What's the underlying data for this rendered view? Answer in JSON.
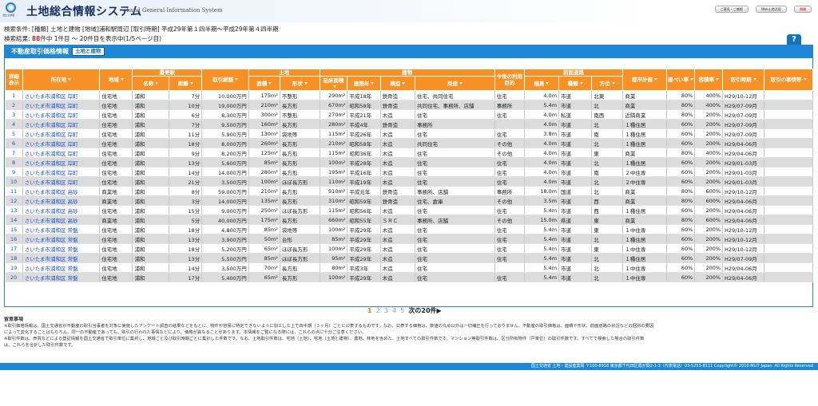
{
  "app": {
    "title": "土地総合情報システム",
    "subtitle": "Land General Information System",
    "logo_text": "国土交通省"
  },
  "header_buttons": [
    "ご意見・ご感想",
    "Web土地活用",
    "閉鎖"
  ],
  "search": {
    "conditions": "検索条件: [種類] 土地と建物 [地域]浦和駅周辺 [取引時期] 平成29年第１四半期〜平成29年第４四半期",
    "count_prefix": "検索結果:",
    "count_value": "88",
    "count_suffix": "件中 1件目 〜 20件目を表示中(1/5ページ目)"
  },
  "help_label": "?",
  "panel": {
    "title": "不動産取引価格情報",
    "tag": "土地と建物"
  },
  "columns": {
    "detail": "詳細表示",
    "location": "所在地",
    "district": "地域",
    "station_group": "最寄駅",
    "station_name": "名称",
    "distance": "距離",
    "price": "取引総額",
    "land_group": "土地",
    "area": "面積",
    "shape": "形状",
    "building_group": "建物",
    "floor_area": "延床面積",
    "year": "建築年",
    "structure": "構造",
    "use": "用途",
    "future_use": "今後の利用目的",
    "road_group": "前面道路",
    "width": "幅員",
    "road_type": "種類",
    "direction": "方位",
    "plan": "都市計画",
    "coverage": "建ぺい率",
    "far": "容積率",
    "period": "取引時期",
    "circumstances": "取引の事情等"
  },
  "rows": [
    [
      "1",
      "さいたま市浦和区 岸町",
      "住宅地",
      "浦和",
      "7分",
      "10,000万円",
      "175m²",
      "不整形",
      "290m²",
      "平成18年",
      "鉄骨造",
      "住宅、共同住宅",
      "住宅",
      "4.0m",
      "市道",
      "北東",
      "商業",
      "80%",
      "400%",
      "H29/10-12月",
      ""
    ],
    [
      "2",
      "さいたま市浦和区 岸町",
      "住宅地",
      "浦和",
      "10分",
      "19,000万円",
      "210m²",
      "長方形",
      "670m²",
      "昭和58年",
      "鉄骨造",
      "共同住宅、事務所、店舗",
      "事務所",
      "5.4m",
      "市道",
      "北",
      "商業",
      "80%",
      "400%",
      "H29/07-09月",
      ""
    ],
    [
      "3",
      "さいたま市浦和区 岸町",
      "住宅地",
      "浦和",
      "6分",
      "8,300万円",
      "300m²",
      "不整形",
      "270m²",
      "平成21年",
      "木造",
      "住宅",
      "住宅",
      "4.0m",
      "私道",
      "南西",
      "近隣商業",
      "80%",
      "200%",
      "H29/07-09月",
      ""
    ],
    [
      "4",
      "さいたま市浦和区 岸町",
      "住宅地",
      "浦和",
      "7分",
      "9,500万円",
      "160m²",
      "長方形",
      "280m²",
      "平成4年",
      "鉄骨造",
      "事務所",
      "",
      "4.0m",
      "市道",
      "北",
      "１種住居",
      "60%",
      "200%",
      "H29/07-09月",
      ""
    ],
    [
      "5",
      "さいたま市浦和区 岸町",
      "住宅地",
      "浦和",
      "11分",
      "5,900万円",
      "130m²",
      "袋地等",
      "115m²",
      "平成26年",
      "木造",
      "住宅",
      "住宅",
      "3.8m",
      "市道",
      "南",
      "１種住居",
      "60%",
      "200%",
      "H29/07-09月",
      ""
    ],
    [
      "6",
      "さいたま市浦和区 岸町",
      "住宅地",
      "浦和",
      "18分",
      "8,000万円",
      "260m²",
      "長方形",
      "210m²",
      "昭和58年",
      "木造",
      "共同住宅",
      "その他",
      "4.0m",
      "市道",
      "北",
      "１種住居",
      "60%",
      "200%",
      "H29/04-06月",
      ""
    ],
    [
      "7",
      "さいたま市浦和区 岸町",
      "住宅地",
      "浦和",
      "9分",
      "8,200万円",
      "125m²",
      "長方形",
      "115m²",
      "昭和36年",
      "木造",
      "住宅",
      "その他",
      "4.0m",
      "市道",
      "東",
      "商業",
      "80%",
      "400%",
      "H29/04-06月",
      ""
    ],
    [
      "8",
      "さいたま市浦和区 岸町",
      "住宅地",
      "浦和",
      "13分",
      "5,600万円",
      "85m²",
      "長方形",
      "100m²",
      "平成28年",
      "木造",
      "住宅",
      "住宅",
      "4.0m",
      "市道",
      "北",
      "１種住居",
      "60%",
      "200%",
      "H29/01-03月",
      ""
    ],
    [
      "9",
      "さいたま市浦和区 岸町",
      "住宅地",
      "浦和",
      "14分",
      "14,000万円",
      "280m²",
      "長方形",
      "195m²",
      "平成16年",
      "木造",
      "住宅",
      "住宅",
      "4.0m",
      "市道",
      "南",
      "２中住専",
      "60%",
      "200%",
      "H29/01-03月",
      ""
    ],
    [
      "10",
      "さいたま市浦和区 岸町",
      "住宅地",
      "浦和",
      "21分",
      "3,500万円",
      "100m²",
      "ほぼ長方形",
      "110m²",
      "平成19年",
      "木造",
      "住宅",
      "住宅",
      "4.0m",
      "市道",
      "北",
      "２中住専",
      "60%",
      "200%",
      "H29/01-03月",
      ""
    ],
    [
      "11",
      "さいたま市浦和区 高砂",
      "商業地",
      "浦和",
      "8分",
      "59,000万円",
      "210m²",
      "長方形",
      "910m²",
      "平成元年",
      "鉄骨造",
      "事務所、店舗",
      "事務所",
      "18.0m",
      "国道",
      "北",
      "商業",
      "80%",
      "600%",
      "H29/10-12月",
      ""
    ],
    [
      "12",
      "さいたま市浦和区 高砂",
      "商業地",
      "浦和",
      "3分",
      "14,000万円",
      "135m²",
      "長方形",
      "310m²",
      "昭和59年",
      "鉄骨造",
      "住宅、倉庫",
      "その他",
      "3.5m",
      "市道",
      "西",
      "商業",
      "80%",
      "600%",
      "H29/04-06月",
      ""
    ],
    [
      "13",
      "さいたま市浦和区 高砂",
      "住宅地",
      "浦和",
      "15分",
      "9,000万円",
      "250m²",
      "ほぼ長方形",
      "115m²",
      "昭和56年",
      "木造",
      "住宅",
      "住宅",
      "5.4m",
      "市道",
      "西",
      "１種住居",
      "60%",
      "200%",
      "H29/04-06月",
      ""
    ],
    [
      "14",
      "さいたま市浦和区 高砂",
      "商業地",
      "浦和",
      "5分",
      "40,000万円",
      "175m²",
      "長方形",
      "660m²",
      "昭和55年",
      "ＳＲＣ",
      "事務所、店舗",
      "その他",
      "15.0m",
      "県道",
      "東",
      "商業",
      "80%",
      "600%",
      "H29/04-06月",
      ""
    ],
    [
      "15",
      "さいたま市浦和区 常盤",
      "住宅地",
      "浦和",
      "18分",
      "4,800万円",
      "85m²",
      "袋地等",
      "100m²",
      "平成29年",
      "木造",
      "住宅",
      "住宅",
      "5.4m",
      "市道",
      "東",
      "１中住専",
      "60%",
      "200%",
      "H29/10-12月",
      ""
    ],
    [
      "16",
      "さいたま市浦和区 常盤",
      "住宅地",
      "浦和",
      "13分",
      "3,900万円",
      "50m²",
      "台形",
      "85m²",
      "平成29年",
      "木造",
      "住宅",
      "住宅",
      "5.4m",
      "市道",
      "北",
      "１種住居",
      "60%",
      "200%",
      "H29/10-12月",
      ""
    ],
    [
      "17",
      "さいたま市浦和区 常盤",
      "住宅地",
      "浦和",
      "18分",
      "5,200万円",
      "65m²",
      "ほぼ長方形",
      "100m²",
      "平成29年",
      "木造",
      "住宅",
      "住宅",
      "5.4m",
      "市道",
      "東",
      "１中住専",
      "60%",
      "200%",
      "H29/10-12月",
      ""
    ],
    [
      "18",
      "さいたま市浦和区 常盤",
      "住宅地",
      "浦和",
      "13分",
      "5,500万円",
      "85m²",
      "ほぼ長方形",
      "95m²",
      "平成29年",
      "木造",
      "住宅",
      "住宅",
      "5.4m",
      "市道",
      "北",
      "１種住居",
      "60%",
      "200%",
      "H29/07-09月",
      ""
    ],
    [
      "19",
      "さいたま市浦和区 常盤",
      "住宅地",
      "浦和",
      "14分",
      "3,500万円",
      "70m²",
      "長方形",
      "80m²",
      "平成3年",
      "木造",
      "住宅",
      "",
      "5.4m",
      "市道",
      "北",
      "１中住専",
      "60%",
      "200%",
      "H29/04-06月",
      ""
    ],
    [
      "20",
      "さいたま市浦和区 常盤",
      "住宅地",
      "浦和",
      "17分",
      "5,400万円",
      "65m²",
      "長方形",
      "100m²",
      "平成29年",
      "木造",
      "住宅",
      "住宅",
      "5.4m",
      "市道",
      "北",
      "１中住専",
      "60%",
      "200%",
      "H29/04-06月",
      ""
    ]
  ],
  "pager": {
    "pages": [
      "1",
      "2",
      "3",
      "4",
      "5"
    ],
    "next": "次の20件▶"
  },
  "notes": {
    "heading": "留意事項",
    "n1": "※取引価格情報は、国土交通省が不動産の取引当事者を対象に実施したアンケート調査の結果などをもとに、物件が容易に特定できないように加工した上で四半期（３ヶ月）ごとに公表するものです。なお、公表する価格は、数値の丸め以外は一切補正を行っておりません。不動産の取引価格は、面積や形状、前面道路の状況などの個別の要因",
    "n2": "によって変化することはもちろん、同一の不動産であっても、取引の行われた事情などにより、価格が異なることがあります。本情報をご覧になる際には、これらの点に十分ご注意ください。",
    "n3": "※取引件数は、売買などによる登記情報を国土交通省で取引単位に集約し、地域ごと及び取引時期ごとに集計した件数です。なお、土地取引件数は、宅地（土地）、宅地（土地と建物）、農地、林地を含めた、土地すべての取引件数です。マンション等取引件数は、区分所有物件（戸単位）の取引件数です。すべてで検索した場合の取引件数",
    "n4": "は、これらを合計した取引件数です。"
  },
  "footer": "国土交通省 土地・建設産業局 〒100-8918 東京都千代田区霞が関2-1-3（代表電話）03-5253-8111 Copyright© 2010 MLIT Japan. All Rights Reserved"
}
